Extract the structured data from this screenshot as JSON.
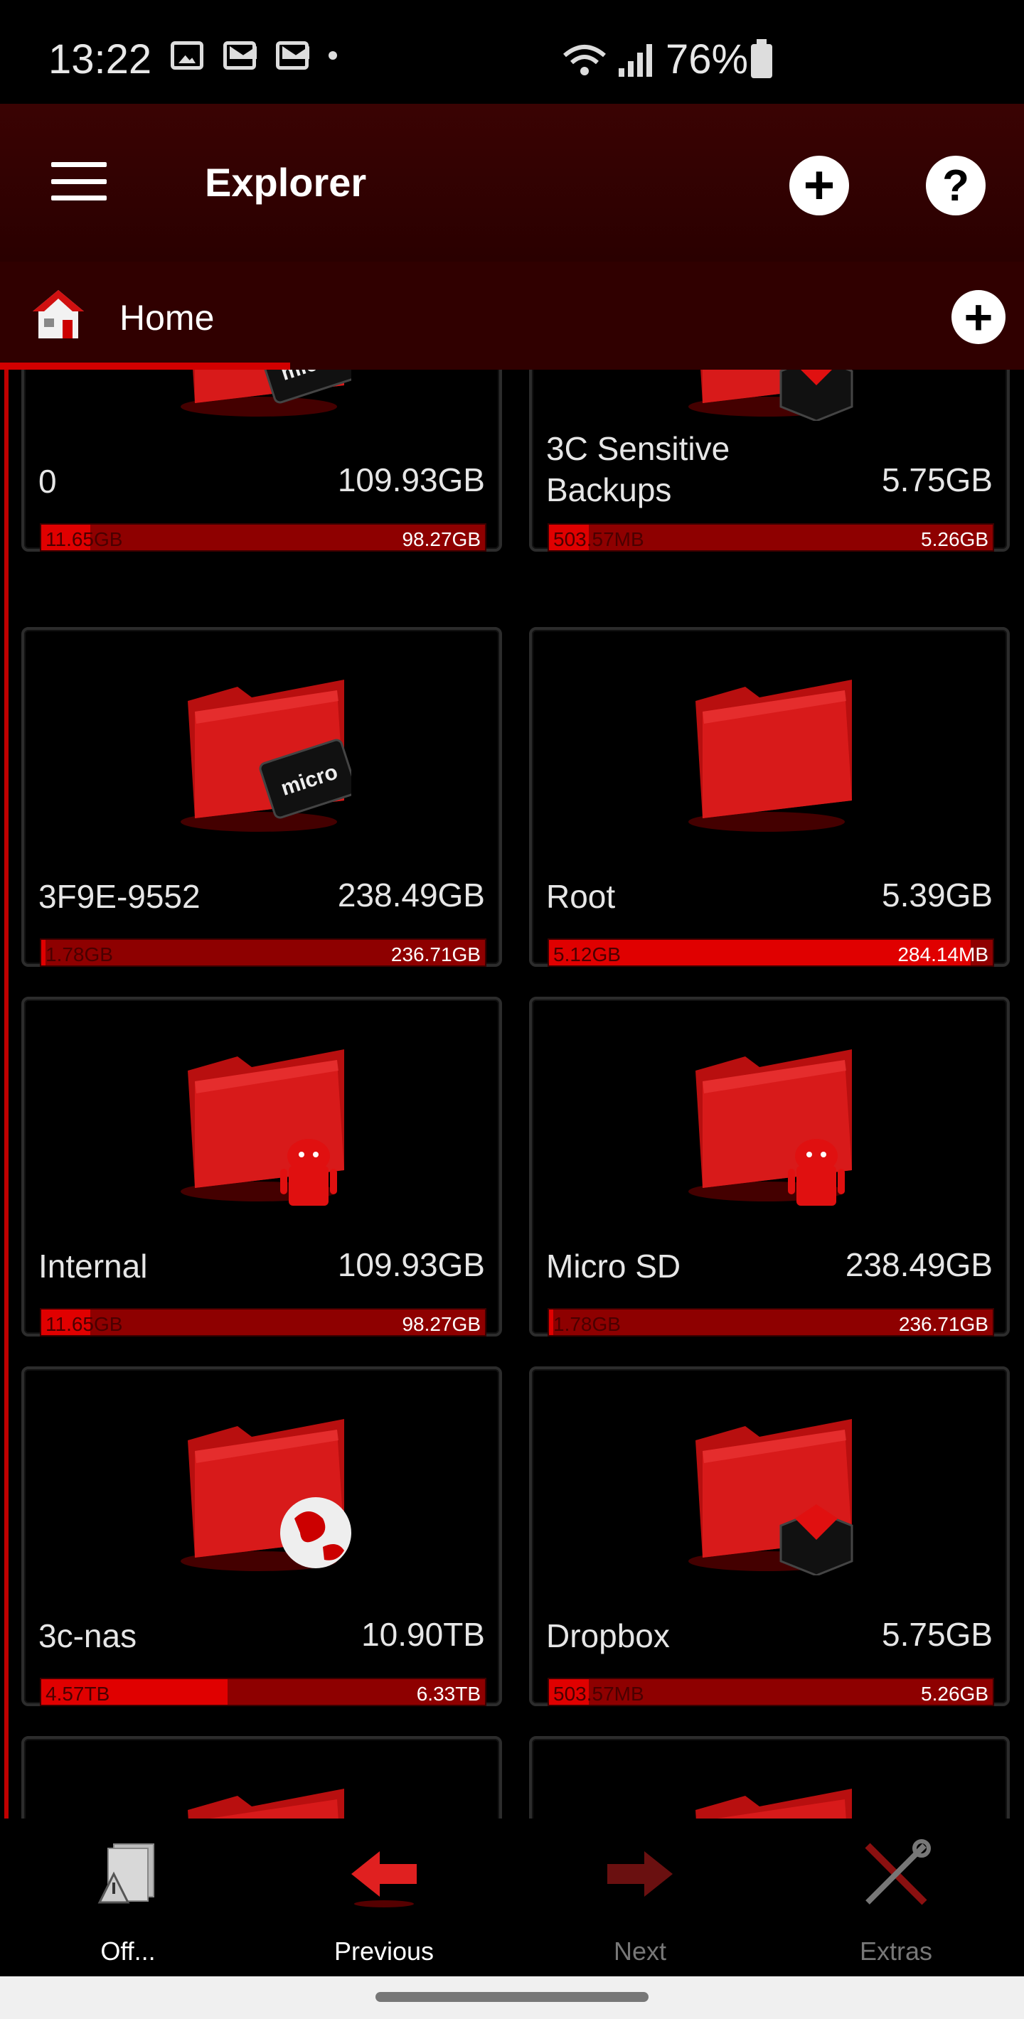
{
  "status_bar": {
    "time": "13:22",
    "battery": "76%"
  },
  "app_bar": {
    "title": "Explorer"
  },
  "tab": {
    "title": "Home"
  },
  "cards": [
    {
      "name": "0",
      "total": "109.93GB",
      "used": "11.65GB",
      "free": "98.27GB",
      "used_fraction": 0.11,
      "badge": "microsd"
    },
    {
      "name": "3C Sensitive Backups",
      "total": "5.75GB",
      "used": "503.57MB",
      "free": "5.26GB",
      "used_fraction": 0.09,
      "badge": "dropbox"
    },
    {
      "name": "3F9E-9552",
      "total": "238.49GB",
      "used": "1.78GB",
      "free": "236.71GB",
      "used_fraction": 0.01,
      "badge": "microsd"
    },
    {
      "name": "Root",
      "total": "5.39GB",
      "used": "5.12GB",
      "free": "284.14MB",
      "used_fraction": 0.95,
      "badge": "none"
    },
    {
      "name": "Internal",
      "total": "109.93GB",
      "used": "11.65GB",
      "free": "98.27GB",
      "used_fraction": 0.11,
      "badge": "android"
    },
    {
      "name": "Micro SD",
      "total": "238.49GB",
      "used": "1.78GB",
      "free": "236.71GB",
      "used_fraction": 0.01,
      "badge": "android"
    },
    {
      "name": "3c-nas",
      "total": "10.90TB",
      "used": "4.57TB",
      "free": "6.33TB",
      "used_fraction": 0.42,
      "badge": "globe"
    },
    {
      "name": "Dropbox",
      "total": "5.75GB",
      "used": "503.57MB",
      "free": "5.26GB",
      "used_fraction": 0.09,
      "badge": "dropbox"
    }
  ],
  "bottom_nav": [
    {
      "label": "Off...",
      "icon": "file-warning-icon",
      "enabled": true
    },
    {
      "label": "Previous",
      "icon": "arrow-left-icon",
      "enabled": true
    },
    {
      "label": "Next",
      "icon": "arrow-right-icon",
      "enabled": false
    },
    {
      "label": "Extras",
      "icon": "tools-icon",
      "enabled": false
    }
  ],
  "colors": {
    "accent": "#d20000",
    "appbar": "#2a0000",
    "bar_free": "#8e0000",
    "bar_used": "#e00000"
  }
}
